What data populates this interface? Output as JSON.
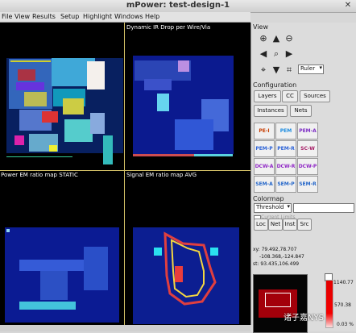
{
  "window": {
    "title": "mPower: test-design-1"
  },
  "menu": [
    "File",
    "View",
    "Results",
    "Setup",
    "Highlight",
    "Windows",
    "Help"
  ],
  "quadrants": {
    "top_left": "",
    "top_right": "Dynamic IR Drop per Wire/Via",
    "bottom_left": "Power EM ratio map STATIC",
    "bottom_right": "Signal EM ratio map AVG"
  },
  "view_panel": {
    "title": "View",
    "dropdown": "Ruler"
  },
  "configuration": {
    "title": "Configuration",
    "tabs": [
      "Layers",
      "CC",
      "Sources",
      "Instances",
      "Nets"
    ],
    "cells": [
      [
        "PE-I",
        "PEM",
        "PEM-A"
      ],
      [
        "PEM-P",
        "PEM-R",
        "SC-W"
      ],
      [
        "DCW-A",
        "DCW-R",
        "DCW-P"
      ],
      [
        "SEM-A",
        "SEM-P",
        "SEM-R"
      ]
    ]
  },
  "colormap": {
    "title": "Colormap",
    "select": "Threshold",
    "checkbox": "Current Limits",
    "buttons": [
      "Loc",
      "Net",
      "Inst",
      "Src"
    ]
  },
  "readout": {
    "xy": "xy: 79.492,78.707",
    "line2": "-108.368,-124.847",
    "line3": "st: 93.435,106.499"
  },
  "scale": {
    "max": "1140.77",
    "mid": "570.38",
    "min": "0.03 %"
  },
  "watermark": "诸子嘉NYS",
  "colors": {
    "background": "#000000",
    "highlight": "#d4c267",
    "accent": "#2255cc"
  }
}
